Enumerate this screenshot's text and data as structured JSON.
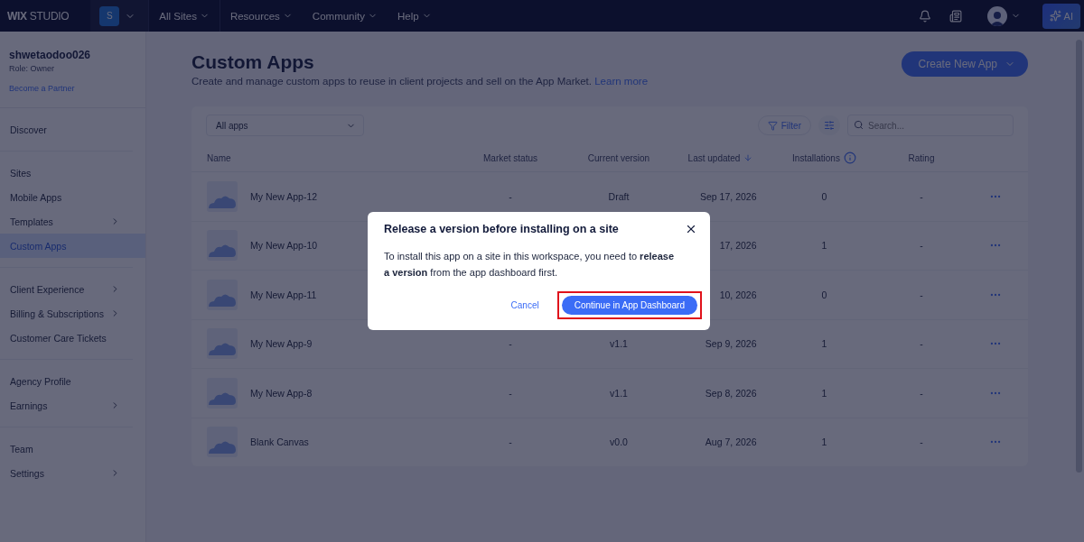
{
  "topbar": {
    "logo": "**WIX** STUDIO",
    "workspace": "S",
    "nav": [
      "All Sites",
      "Resources",
      "Community",
      "Help"
    ],
    "ai_button": "AI"
  },
  "sidebar": {
    "user": "shwetaodoo026",
    "role": "Role: Owner",
    "partner_link": "Become a Partner",
    "groups": [
      {
        "items": [
          {
            "label": "Discover",
            "has_submenu": false,
            "selected": false
          }
        ]
      },
      {
        "items": [
          {
            "label": "Sites",
            "has_submenu": false,
            "selected": false
          },
          {
            "label": "Mobile Apps",
            "has_submenu": false,
            "selected": false
          },
          {
            "label": "Templates",
            "has_submenu": true,
            "selected": false
          },
          {
            "label": "Custom Apps",
            "has_submenu": false,
            "selected": true
          }
        ]
      },
      {
        "items": [
          {
            "label": "Client Experience",
            "has_submenu": true,
            "selected": false
          },
          {
            "label": "Billing & Subscriptions",
            "has_submenu": true,
            "selected": false
          },
          {
            "label": "Customer Care Tickets",
            "has_submenu": false,
            "selected": false
          }
        ]
      },
      {
        "items": [
          {
            "label": "Agency Profile",
            "has_submenu": false,
            "selected": false
          },
          {
            "label": "Earnings",
            "has_submenu": true,
            "selected": false
          }
        ]
      },
      {
        "items": [
          {
            "label": "Team",
            "has_submenu": false,
            "selected": false
          },
          {
            "label": "Settings",
            "has_submenu": true,
            "selected": false
          }
        ]
      }
    ]
  },
  "page": {
    "title": "Custom Apps",
    "subtitle": "Create and manage custom apps to reuse in client projects and sell on the App Market.",
    "learn_more": "Learn more",
    "create_button": "Create New App"
  },
  "table": {
    "filter_select": "All apps",
    "filter_button": "Filter",
    "search": {
      "placeholder": "Search..."
    },
    "columns": [
      "Name",
      "Market status",
      "Current version",
      "Last updated",
      "Installations",
      "Rating"
    ],
    "rows": [
      {
        "name": "My New App-12",
        "market_status": "-",
        "version": "Draft",
        "last_updated": "Sep 17, 2026",
        "installations": "0",
        "rating": "-"
      },
      {
        "name": "My New App-10",
        "last_updated": "17, 2026",
        "installations": "1",
        "rating": "-"
      },
      {
        "name": "My New App-11",
        "last_updated": "10, 2026",
        "installations": "0",
        "rating": "-"
      },
      {
        "name": "My New App-9",
        "market_status": "-",
        "version": "v1.1",
        "last_updated": "Sep 9, 2026",
        "installations": "1",
        "rating": "-"
      },
      {
        "name": "My New App-8",
        "market_status": "-",
        "version": "v1.1",
        "last_updated": "Sep 8, 2026",
        "installations": "1",
        "rating": "-"
      },
      {
        "name": "Blank Canvas",
        "market_status": "-",
        "version": "v0.0",
        "last_updated": "Aug 7, 2026",
        "installations": "1",
        "rating": "-"
      }
    ]
  },
  "dialog": {
    "title": "Release a version before installing on a site",
    "body": "To install this app on a site in this workspace, you need to **release a version** from the app dashboard first.",
    "cancel": "Cancel",
    "confirm": "Continue in App Dashboard",
    "confirm_highlighted": true
  }
}
